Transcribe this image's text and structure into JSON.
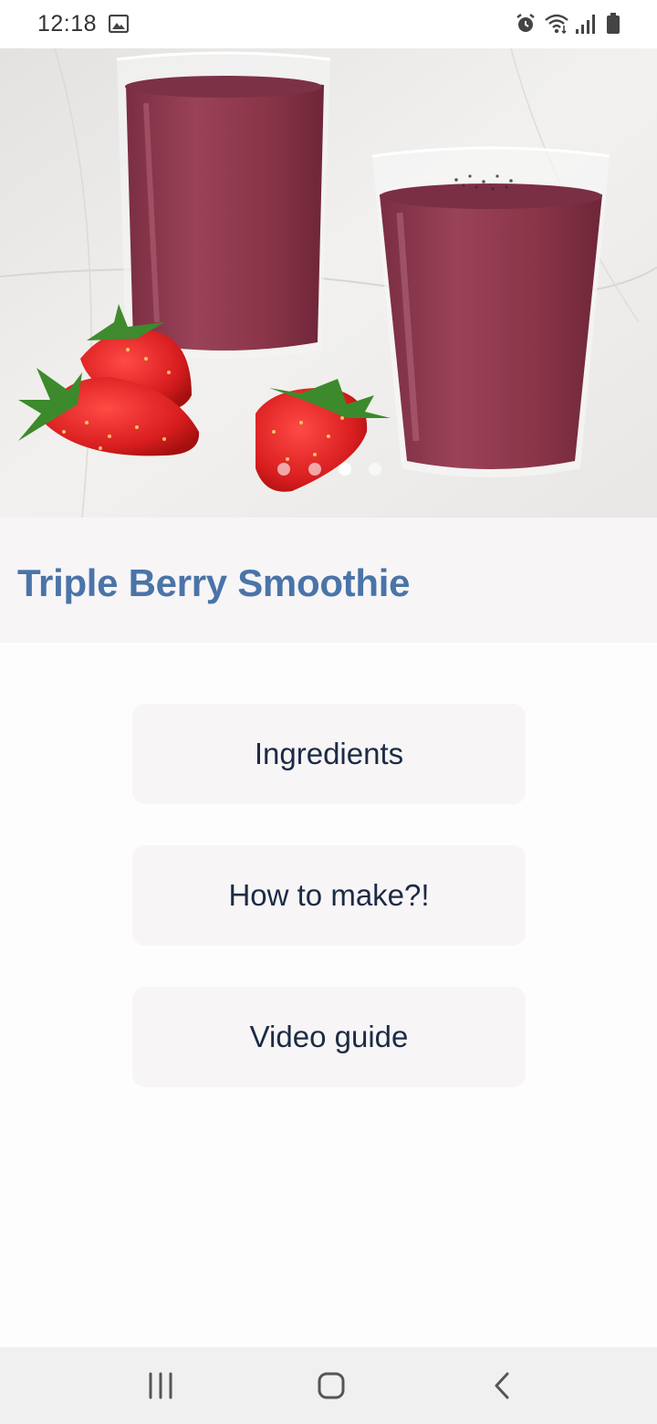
{
  "status_bar": {
    "time": "12:18",
    "left_icons": [
      "image-icon"
    ],
    "right_icons": [
      "alarm-icon",
      "wifi-icon",
      "signal-icon",
      "battery-icon"
    ]
  },
  "hero": {
    "image": "strawberry-smoothie-photo",
    "slide_count": 4,
    "active_slide": 3
  },
  "recipe": {
    "title": "Triple Berry Smoothie"
  },
  "options": [
    {
      "label": "Ingredients"
    },
    {
      "label": "How to make?!"
    },
    {
      "label": "Video guide"
    }
  ],
  "nav_bar": {
    "buttons": [
      "recent-apps-icon",
      "home-icon",
      "back-icon"
    ]
  },
  "colors": {
    "title": "#4a74a8",
    "button_bg": "#f7f5f6",
    "button_text": "#1c2b45",
    "smoothie": "#8a3346"
  }
}
